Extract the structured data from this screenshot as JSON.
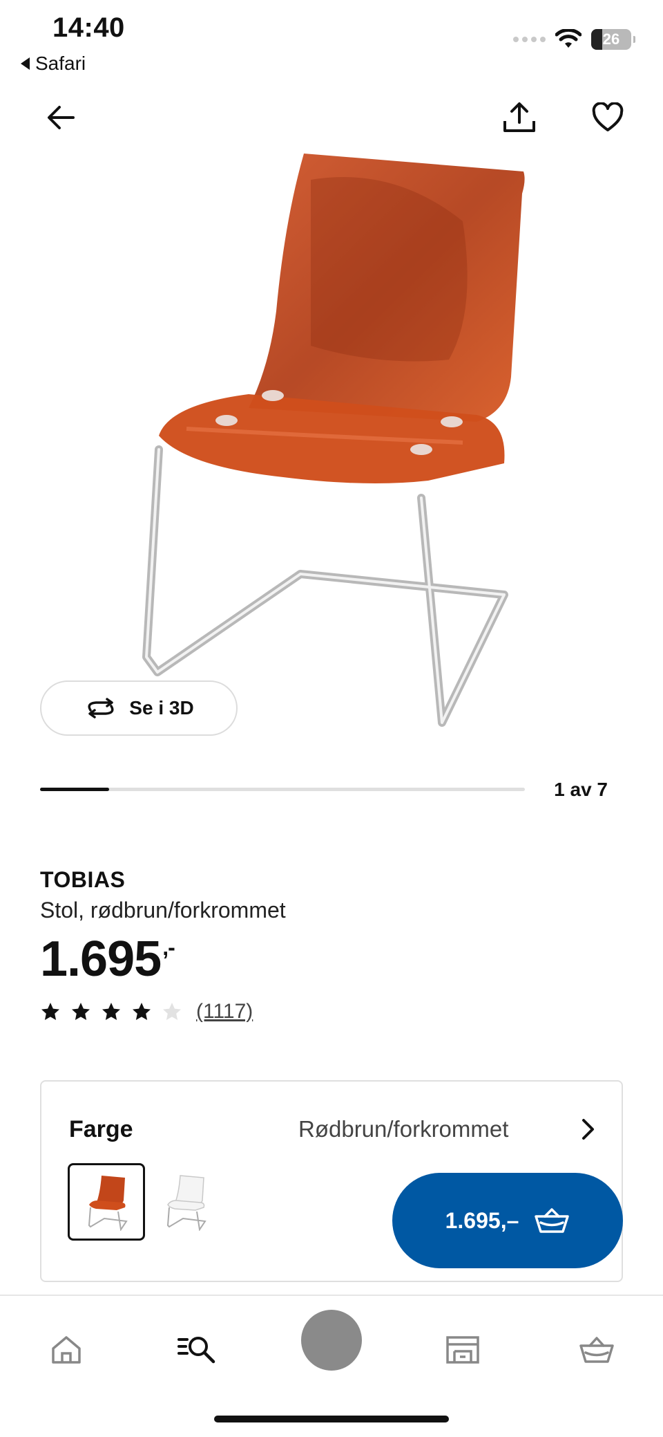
{
  "status_bar": {
    "time": "14:40",
    "back_app": "Safari",
    "battery": "26",
    "battery_level": 0.26
  },
  "header": {
    "back_icon": "arrow-left-icon",
    "share_icon": "share-icon",
    "favorite_icon": "heart-icon"
  },
  "media": {
    "view_3d_label": "Se i 3D",
    "view_3d_icon": "rotate-3d-icon",
    "carousel_position": 1,
    "carousel_total": 7,
    "carousel_counter": "1 av 7"
  },
  "product": {
    "name": "TOBIAS",
    "description": "Stol, rødbrun/forkrommet",
    "price": "1.695",
    "price_suffix": ",-",
    "rating": 4,
    "rating_max": 5,
    "review_count": "(1117)"
  },
  "color_selector": {
    "label": "Farge",
    "value": "Rødbrun/forkrommet",
    "swatches": [
      {
        "name": "Rødbrun/forkrommet",
        "selected": true
      },
      {
        "name": "Transparent",
        "selected": false
      }
    ]
  },
  "add_to_cart": {
    "label": "1.695,–",
    "icon": "basket-icon",
    "color": "#0058a3"
  },
  "tabbar": {
    "items": [
      "home-icon",
      "search-icon",
      "profile-avatar",
      "store-icon",
      "basket-icon"
    ]
  },
  "colors": {
    "accent": "#0058a3",
    "text": "#111111",
    "chair": "#c2461a"
  }
}
